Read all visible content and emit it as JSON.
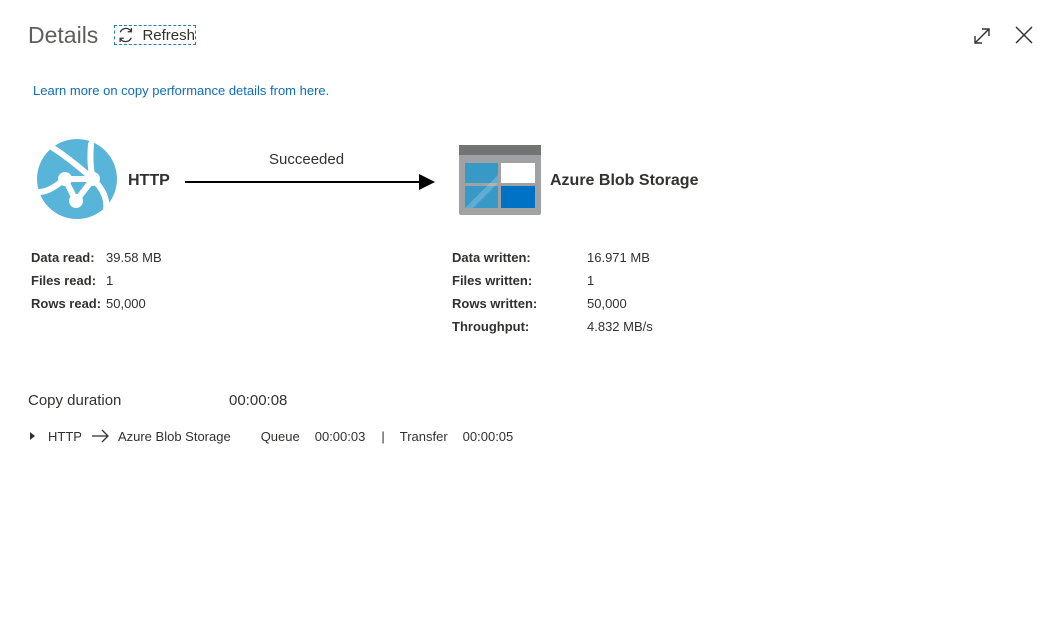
{
  "header": {
    "title": "Details",
    "refresh_label": "Refresh",
    "icons": {
      "refresh": "refresh-icon",
      "expand": "expand-icon",
      "close": "close-icon"
    }
  },
  "link": {
    "text": "Learn more on copy performance details from here."
  },
  "source": {
    "name": "HTTP",
    "icon": "http-globe-icon",
    "stats": [
      {
        "label": "Data read:",
        "value": "39.58 MB"
      },
      {
        "label": "Files read:",
        "value": "1"
      },
      {
        "label": "Rows read:",
        "value": "50,000"
      }
    ]
  },
  "flow": {
    "status": "Succeeded"
  },
  "sink": {
    "name": "Azure Blob Storage",
    "icon": "blob-storage-icon",
    "stats": [
      {
        "label": "Data written:",
        "value": "16.971 MB"
      },
      {
        "label": "Files written:",
        "value": "1"
      },
      {
        "label": "Rows written:",
        "value": "50,000"
      },
      {
        "label": "Throughput:",
        "value": "4.832 MB/s"
      }
    ]
  },
  "duration": {
    "label": "Copy duration",
    "value": "00:00:08",
    "detail": {
      "source": "HTTP",
      "sink": "Azure Blob Storage",
      "queue_label": "Queue",
      "queue_value": "00:00:03",
      "separator": "|",
      "transfer_label": "Transfer",
      "transfer_value": "00:00:05"
    }
  },
  "colors": {
    "link": "#0f6cbd",
    "http_icon": "#59b4d9",
    "blob_dark": "#0072c6",
    "blob_light": "#3999c6",
    "focus": "#1b7fc4"
  }
}
